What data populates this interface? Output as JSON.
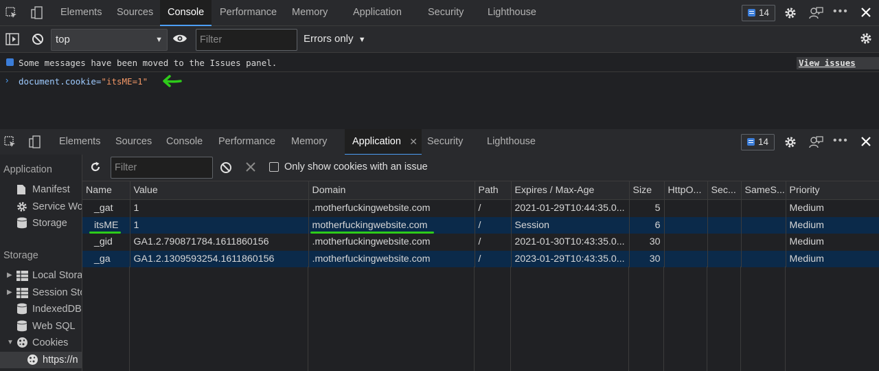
{
  "top_tabs": [
    "Elements",
    "Sources",
    "Console",
    "Performance",
    "Memory",
    "Application",
    "Security",
    "Lighthouse"
  ],
  "top_active": "Console",
  "issues_count": "14",
  "console_toolbar": {
    "context": "top",
    "filter_placeholder": "Filter",
    "levels": "Errors only"
  },
  "console": {
    "info_message": "Some messages have been moved to the Issues panel.",
    "view_issues": "View issues",
    "command_prefix": "document.cookie=",
    "command_value": "\"itsME=1\""
  },
  "bottom_tabs": [
    "Elements",
    "Sources",
    "Console",
    "Performance",
    "Memory",
    "Application",
    "Security",
    "Lighthouse"
  ],
  "bottom_active": "Application",
  "sidebar": {
    "application_header": "Application",
    "app_items": [
      "Manifest",
      "Service Wo",
      "Storage"
    ],
    "storage_header": "Storage",
    "storage_items": [
      "Local Stora",
      "Session Sto",
      "IndexedDB",
      "Web SQL",
      "Cookies"
    ],
    "cookie_origin": "https://n"
  },
  "cookies_toolbar": {
    "filter_placeholder": "Filter",
    "only_issue_label": "Only show cookies with an issue"
  },
  "cookies_table": {
    "columns": [
      "Name",
      "Value",
      "Domain",
      "Path",
      "Expires / Max-Age",
      "Size",
      "HttpO...",
      "Sec...",
      "SameS...",
      "Priority"
    ],
    "rows": [
      {
        "name": "_gat",
        "value": "1",
        "domain": ".motherfuckingwebsite.com",
        "path": "/",
        "expires": "2021-01-29T10:44:35.0...",
        "size": "5",
        "priority": "Medium"
      },
      {
        "name": "itsME",
        "value": "1",
        "domain": "motherfuckingwebsite.com",
        "path": "/",
        "expires": "Session",
        "size": "6",
        "priority": "Medium"
      },
      {
        "name": "_gid",
        "value": "GA1.2.790871784.1611860156",
        "domain": ".motherfuckingwebsite.com",
        "path": "/",
        "expires": "2021-01-30T10:43:35.0...",
        "size": "30",
        "priority": "Medium"
      },
      {
        "name": "_ga",
        "value": "GA1.2.1309593254.1611860156",
        "domain": ".motherfuckingwebsite.com",
        "path": "/",
        "expires": "2023-01-29T10:43:35.0...",
        "size": "30",
        "priority": "Medium"
      }
    ]
  },
  "colors": {
    "annotation": "#2ecc1a",
    "selected_row": "#0b2a4a",
    "accent": "#4d9ff5"
  }
}
